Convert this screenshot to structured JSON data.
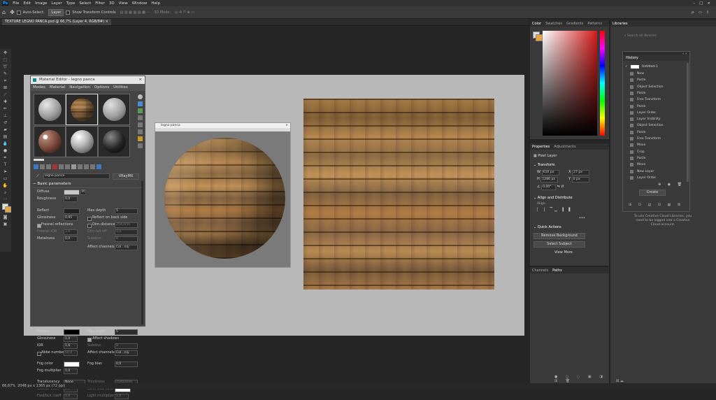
{
  "menubar": {
    "app_icon": "Ps",
    "items": [
      "File",
      "Edit",
      "Image",
      "Layer",
      "Type",
      "Select",
      "Filter",
      "3D",
      "View",
      "Window",
      "Help"
    ],
    "window_controls": [
      "–",
      "□",
      "×"
    ]
  },
  "options_bar": {
    "auto_select_label": "Auto-Select:",
    "auto_select_value": "Layer",
    "show_transform_label": "Show Transform Controls",
    "mode_3d": "3D Mode:"
  },
  "document_tab": {
    "title": "TEXTURE LEGNO PANCA.psd @ 66,7% (Layer 4, RGB/8#)"
  },
  "status_bar": {
    "zoom": "66,67%",
    "doc_info": "2048 px x 1365 px (72 ppi)"
  },
  "material_editor": {
    "title": "Material Editor - legno panca",
    "menu": [
      "Modes",
      "Material",
      "Navigation",
      "Options",
      "Utilities"
    ],
    "material_name": "legno panca",
    "renderer": "VRayMtl",
    "section_title": "Basic parameters",
    "params": {
      "diffuse": "Diffuse",
      "diffuse_map": "M",
      "roughness": "Roughness",
      "roughness_val": "0,0",
      "reflect": "Reflect",
      "max_depth": "Max depth",
      "max_depth_val": "5",
      "glossiness": "Glossiness",
      "glossiness_val": "0,95",
      "reflect_on_back": "Reflect on back side",
      "fresnel": "Fresnel reflections",
      "dim_distance": "Dim distance",
      "dim_distance_val": "254,0cm",
      "fresnel_ior": "Fresnel IOR",
      "fresnel_ior_val": "1,6",
      "dim_falloff": "Dim fall off",
      "dim_falloff_val": "0,0",
      "metalness": "Metalness",
      "metalness_val": "0,0",
      "subdivs": "Subdivs",
      "subdivs_val": "8",
      "affect_channels": "Affect channels",
      "affect_channels_val": "Col...nly",
      "refract": "Refract",
      "refract_max_depth": "Max depth",
      "refract_max_depth_val": "5",
      "refract_gloss": "Glossiness",
      "refract_gloss_val": "1,0",
      "affect_shadows": "Affect shadows",
      "ior": "IOR",
      "ior_val": "1,6",
      "refract_subdivs": "Subdivs",
      "refract_subdivs_val": "8",
      "abbe": "Abbe number",
      "abbe_val": "50,0",
      "refract_affect": "Affect channels",
      "refract_affect_val": "Col...nly",
      "fog_color": "Fog color",
      "fog_bias": "Fog bias",
      "fog_bias_val": "0,0",
      "fog_multiplier": "Fog multiplier",
      "fog_multiplier_val": "1,0",
      "translucency": "Translucency",
      "translucency_val": "None",
      "thickness": "Thickness",
      "thickness_val": "2540,0cm",
      "scatter_coeff": "Scatter coeff",
      "scatter_val": "0,0",
      "back_side_color": "Back-side color",
      "fwd_bwd": "Fwd/bck coeff",
      "fwd_bwd_val": "1,0",
      "light_multiplier": "Light multiplier",
      "light_multiplier_val": "1,0"
    }
  },
  "preview_window": {
    "title": "legno panca",
    "close": "×"
  },
  "color_panel": {
    "tabs": [
      "Color",
      "Swatches",
      "Gradients",
      "Patterns"
    ],
    "accent": "#cc1f1f",
    "fg_swatch": "#dddddd",
    "bg_swatch": "#e8a43a"
  },
  "properties_panel": {
    "tabs": [
      "Properties",
      "Adjustments"
    ],
    "layer_type": "Pixel Layer",
    "transform_title": "Transform",
    "w_label": "W",
    "w_val": "610 px",
    "x_label": "X",
    "x_val": "27 px",
    "h_label": "H",
    "h_val": "1286 px",
    "y_label": "Y",
    "y_val": "0 px",
    "angle_val": "0,00°",
    "align_title": "Align and Distribute",
    "align_label": "Align:",
    "more": "•••",
    "quick_title": "Quick Actions",
    "remove_bg": "Remove Background",
    "select_subject": "Select Subject",
    "view_more": "View More"
  },
  "channels_panel": {
    "tabs": [
      "Channels",
      "Paths"
    ]
  },
  "libraries_panel": {
    "tab": "Libraries",
    "search_placeholder": "Search all libraries",
    "message": "To use Creative Cloud Libraries, you need to be logged into a Creative Cloud account."
  },
  "history_panel": {
    "title": "History",
    "snapshot": "Untitled-1",
    "items": [
      "New",
      "Paste",
      "Object Selection",
      "Paste",
      "Free Transform",
      "Paste",
      "Layer Order",
      "Layer Visibility",
      "Object Selection",
      "Paste",
      "Free Transform",
      "Move",
      "Crop",
      "Paste",
      "Move",
      "New Layer",
      "Layer Order"
    ],
    "create_button": "Create"
  }
}
